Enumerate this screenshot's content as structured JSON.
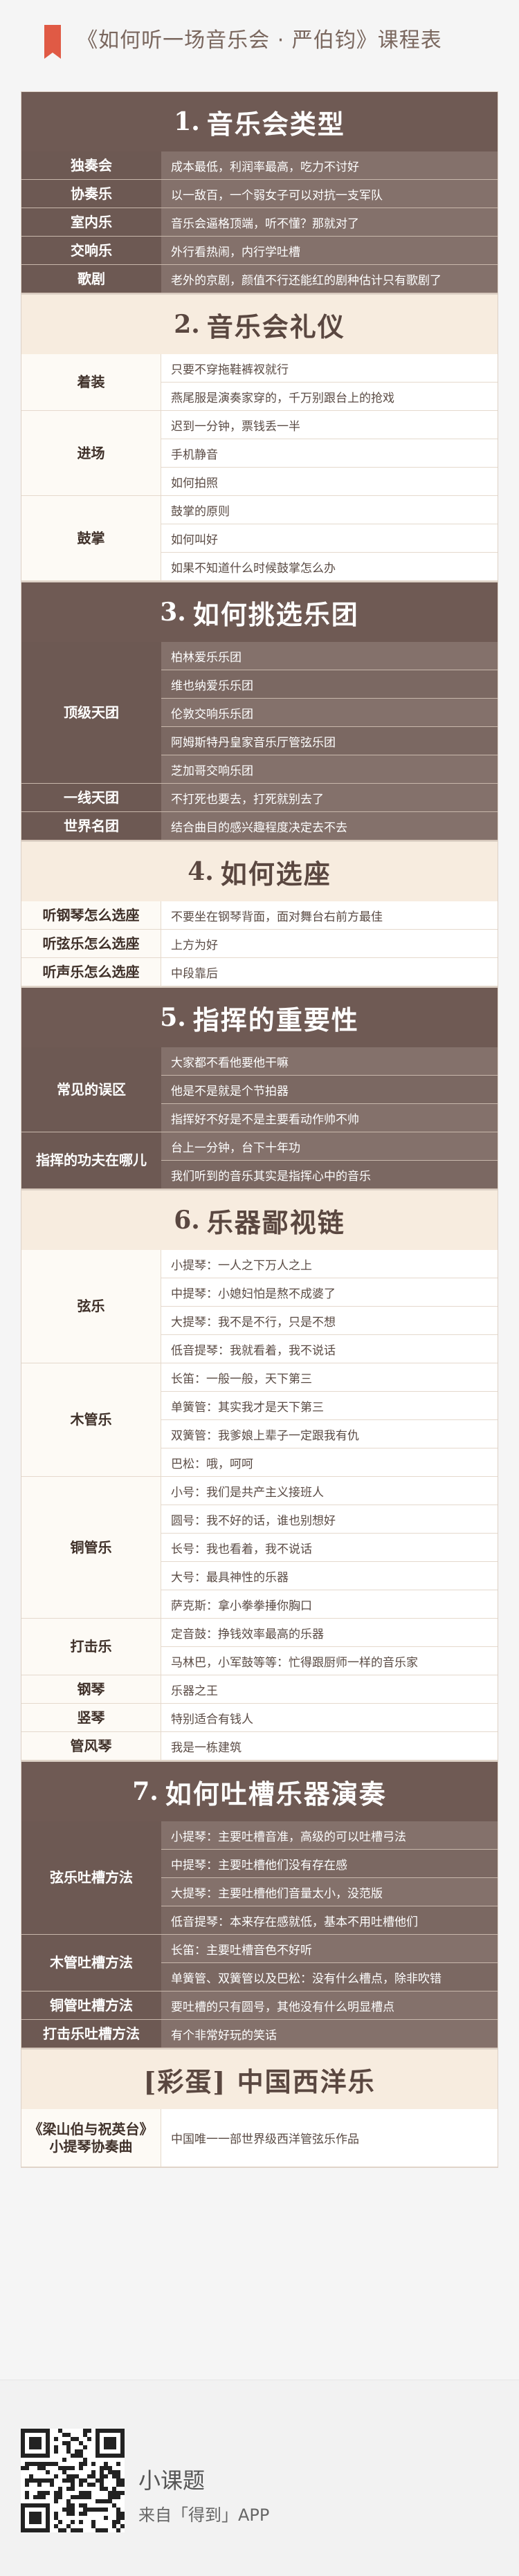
{
  "page_title": "《如何听一场音乐会 · 严伯钧》课程表",
  "sections": [
    {
      "num": "1.",
      "title": "音乐会类型",
      "theme": "dark",
      "label_width": 202,
      "groups": [
        {
          "label": "独奏会",
          "items": [
            "成本最低，利润率最高，吃力不讨好"
          ]
        },
        {
          "label": "协奏乐",
          "items": [
            "以一敌百，一个弱女子可以对抗一支军队"
          ]
        },
        {
          "label": "室内乐",
          "items": [
            "音乐会逼格顶端，听不懂？那就对了"
          ]
        },
        {
          "label": "交响乐",
          "items": [
            "外行看热闹，内行学吐槽"
          ]
        },
        {
          "label": "歌剧",
          "items": [
            "老外的京剧，颜值不行还能红的剧种估计只有歌剧了"
          ]
        }
      ]
    },
    {
      "num": "2.",
      "title": "音乐会礼仪",
      "theme": "light",
      "label_width": 202,
      "groups": [
        {
          "label": "着装",
          "items": [
            "只要不穿拖鞋裤衩就行",
            "燕尾服是演奏家穿的，千万别跟台上的抢戏"
          ]
        },
        {
          "label": "进场",
          "items": [
            "迟到一分钟，票钱丢一半",
            "手机静音",
            "如何拍照"
          ]
        },
        {
          "label": "鼓掌",
          "items": [
            "鼓掌的原则",
            "如何叫好",
            "如果不知道什么时候鼓掌怎么办"
          ]
        }
      ]
    },
    {
      "num": "3.",
      "title": "如何挑选乐团",
      "theme": "dark",
      "label_width": 202,
      "groups": [
        {
          "label": "顶级天团",
          "items": [
            "柏林爱乐乐团",
            "维也纳爱乐乐团",
            "伦敦交响乐乐团",
            "阿姆斯特丹皇家音乐厅管弦乐团",
            "芝加哥交响乐团"
          ]
        },
        {
          "label": "一线天团",
          "items": [
            "不打死也要去，打死就别去了"
          ]
        },
        {
          "label": "世界名团",
          "items": [
            "结合曲目的感兴趣程度决定去不去"
          ]
        }
      ]
    },
    {
      "num": "4.",
      "title": "如何选座",
      "theme": "light",
      "label_width": 202,
      "groups": [
        {
          "label": "听钢琴怎么选座",
          "items": [
            "不要坐在钢琴背面，面对舞台右前方最佳"
          ]
        },
        {
          "label": "听弦乐怎么选座",
          "items": [
            "上方为好"
          ]
        },
        {
          "label": "听声乐怎么选座",
          "items": [
            "中段靠后"
          ]
        }
      ]
    },
    {
      "num": "5.",
      "title": "指挥的重要性",
      "theme": "dark",
      "label_width": 202,
      "groups": [
        {
          "label": "常见的误区",
          "items": [
            "大家都不看他要他干嘛",
            "他是不是就是个节拍器",
            "指挥好不好是不是主要看动作帅不帅"
          ]
        },
        {
          "label": "指挥的功夫在哪儿",
          "items": [
            "台上一分钟，台下十年功",
            "我们听到的音乐其实是指挥心中的音乐"
          ]
        }
      ]
    },
    {
      "num": "6.",
      "title": "乐器鄙视链",
      "theme": "light",
      "label_width": 202,
      "groups": [
        {
          "label": "弦乐",
          "items": [
            "小提琴：一人之下万人之上",
            "中提琴：小媳妇怕是熬不成婆了",
            "大提琴：我不是不行，只是不想",
            "低音提琴：我就看着，我不说话"
          ]
        },
        {
          "label": "木管乐",
          "items": [
            "长笛：一般一般，天下第三",
            "单簧管：其实我才是天下第三",
            "双簧管：我爹娘上辈子一定跟我有仇",
            "巴松：哦，呵呵"
          ]
        },
        {
          "label": "铜管乐",
          "items": [
            "小号：我们是共产主义接班人",
            "圆号：我不好的话，谁也别想好",
            "长号：我也看着，我不说话",
            "大号：最具神性的乐器",
            "萨克斯：拿小拳拳捶你胸口"
          ]
        },
        {
          "label": "打击乐",
          "items": [
            "定音鼓：挣钱效率最高的乐器",
            "马林巴，小军鼓等等：忙得跟厨师一样的音乐家"
          ]
        },
        {
          "label": "钢琴",
          "items": [
            "乐器之王"
          ]
        },
        {
          "label": "竖琴",
          "items": [
            "特别适合有钱人"
          ]
        },
        {
          "label": "管风琴",
          "items": [
            "我是一栋建筑"
          ]
        }
      ]
    },
    {
      "num": "7.",
      "title": "如何吐槽乐器演奏",
      "theme": "dark",
      "label_width": 202,
      "groups": [
        {
          "label": "弦乐吐槽方法",
          "items": [
            "小提琴：主要吐槽音准，高级的可以吐槽弓法",
            "中提琴：主要吐槽他们没有存在感",
            "大提琴：主要吐槽他们音量太小，没范版",
            "低音提琴：本来存在感就低，基本不用吐槽他们"
          ]
        },
        {
          "label": "木管吐槽方法",
          "items": [
            "长笛：主要吐槽音色不好听",
            "单簧管、双簧管以及巴松：没有什么槽点，除非吹错"
          ]
        },
        {
          "label": "铜管吐槽方法",
          "items": [
            "要吐槽的只有圆号，其他没有什么明显槽点"
          ]
        },
        {
          "label": "打击乐吐槽方法",
          "items": [
            "有个非常好玩的笑话"
          ]
        }
      ]
    },
    {
      "num": "",
      "title": "[彩蛋] 中国西洋乐",
      "theme": "light",
      "label_width": 202,
      "groups": [
        {
          "label": "《梁山伯与祝英台》小提琴协奏曲",
          "items": [
            "中国唯一一部世界级西洋管弦乐作品"
          ]
        }
      ]
    }
  ],
  "footer": {
    "title": "小课题",
    "source": "来自「得到」APP",
    "qr_icon": "qr-code-icon"
  }
}
